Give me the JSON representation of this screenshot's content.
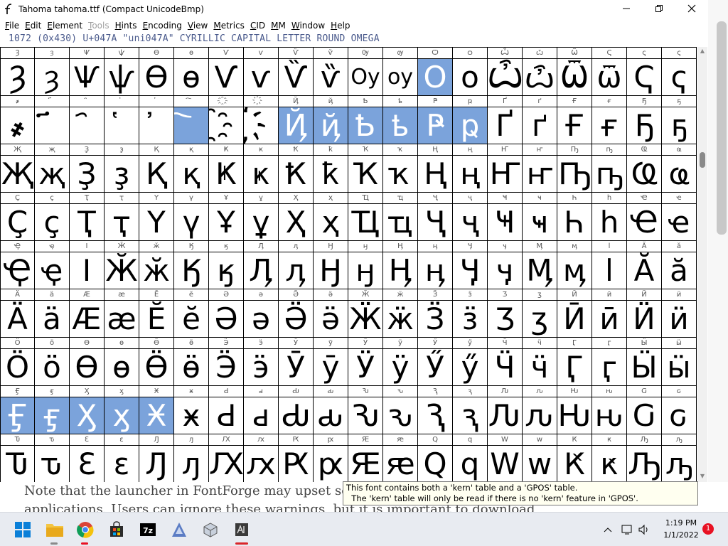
{
  "window": {
    "title": "Tahoma  tahoma.ttf (Compact UnicodeBmp)",
    "icon": "fontforge-icon",
    "minimize_glyph": "—",
    "maximize_glyph": "□",
    "close_glyph": "✕"
  },
  "menu": [
    {
      "label": "File",
      "u": "F",
      "rest": "ile",
      "enabled": true
    },
    {
      "label": "Edit",
      "u": "E",
      "rest": "dit",
      "enabled": true
    },
    {
      "label": "Element",
      "u": "E",
      "rest": "lement",
      "enabled": true
    },
    {
      "label": "Tools",
      "u": "T",
      "rest": "ools",
      "enabled": false
    },
    {
      "label": "Hints",
      "u": "H",
      "rest": "ints",
      "enabled": true
    },
    {
      "label": "Encoding",
      "u": "E",
      "rest": "ncoding",
      "enabled": true
    },
    {
      "label": "View",
      "u": "V",
      "rest": "iew",
      "enabled": true
    },
    {
      "label": "Metrics",
      "u": "M",
      "rest": "etrics",
      "enabled": true
    },
    {
      "label": "CID",
      "u": "C",
      "rest": "ID",
      "enabled": true
    },
    {
      "label": "MM",
      "u": "M",
      "rest": "M",
      "enabled": true
    },
    {
      "label": "Window",
      "u": "W",
      "rest": "indow",
      "enabled": true
    },
    {
      "label": "Help",
      "u": "H",
      "rest": "elp",
      "enabled": true
    }
  ],
  "info_line": "1072 (0x430) U+047A \"uni047A\" CYRILLIC CAPITAL LETTER ROUND OMEGA",
  "glyph_rows": [
    {
      "labels": [
        "Ȝ",
        "ȝ",
        "Ѱ",
        "ѱ",
        "Ѳ",
        "ѳ",
        "Ѵ",
        "ѵ",
        "Ѷ",
        "ѷ",
        "Ѹ",
        "ѹ",
        "Ѻ",
        "ѻ",
        "Ѽ",
        "ѽ",
        "Ѿ",
        "Ҁ",
        "ҁ",
        "ҁ"
      ],
      "glyphs": [
        "Ȝ",
        "ȝ",
        "Ѱ",
        "ѱ",
        "Ѳ",
        "ѳ",
        "Ѵ",
        "ѵ",
        "Ѷ",
        "ѷ",
        "Оу",
        "оу",
        "О",
        "о",
        "Ѽ",
        "ѽ",
        "Ѿ",
        "ѿ",
        "Ҁ",
        "ҁ"
      ],
      "selected": [
        12
      ]
    },
    {
      "labels": [
        "҂",
        "҃",
        "҄",
        "҅",
        "҆",
        "҇",
        "҈",
        "҉",
        "Ҋ",
        "ҋ",
        "Ҍ",
        "ҍ",
        "Ҏ",
        "ҏ",
        "Ґ",
        "ґ",
        "Ғ",
        "ғ",
        "Ҕ",
        "ҕ"
      ],
      "glyphs": [
        "҂",
        "҃",
        "҄",
        "҅",
        "҆",
        "҇",
        "҈",
        "҉",
        "Ҋ",
        "ҋ",
        "Ҍ",
        "ҍ",
        "Ҏ",
        "ҏ",
        "Ґ",
        "ґ",
        "Ғ",
        "ғ",
        "Ҕ",
        "ҕ"
      ],
      "selected": [
        5,
        8,
        9,
        10,
        11,
        12,
        13
      ]
    },
    {
      "labels": [
        "Җ",
        "җ",
        "Ҙ",
        "ҙ",
        "Қ",
        "қ",
        "Ҝ",
        "ҝ",
        "Ҟ",
        "ҟ",
        "Ҡ",
        "ҡ",
        "Ң",
        "ң",
        "Ҥ",
        "ҥ",
        "Ҧ",
        "ҧ",
        "Ҩ",
        "ҩ"
      ],
      "glyphs": [
        "Җ",
        "җ",
        "Ҙ",
        "ҙ",
        "Қ",
        "қ",
        "Ҝ",
        "ҝ",
        "Ҟ",
        "ҟ",
        "Ҡ",
        "ҡ",
        "Ң",
        "ң",
        "Ҥ",
        "ҥ",
        "Ҧ",
        "ҧ",
        "Ҩ",
        "ҩ"
      ],
      "selected": []
    },
    {
      "labels": [
        "Ҫ",
        "ҫ",
        "Ҭ",
        "ҭ",
        "Ү",
        "ү",
        "Ұ",
        "ұ",
        "Ҳ",
        "ҳ",
        "Ҵ",
        "ҵ",
        "Ҷ",
        "ҷ",
        "Ҹ",
        "ҹ",
        "Һ",
        "һ",
        "Ҽ",
        "ҽ"
      ],
      "glyphs": [
        "Ҫ",
        "ҫ",
        "Ҭ",
        "ҭ",
        "Ү",
        "ү",
        "Ұ",
        "ұ",
        "Ҳ",
        "ҳ",
        "Ҵ",
        "ҵ",
        "Ҷ",
        "ҷ",
        "Ҹ",
        "ҹ",
        "Һ",
        "һ",
        "Ҽ",
        "ҽ"
      ],
      "selected": []
    },
    {
      "labels": [
        "Ҿ",
        "ҿ",
        "Ӏ",
        "Ӂ",
        "ӂ",
        "Ӄ",
        "ӄ",
        "Ӆ",
        "ӆ",
        "Ӈ",
        "ӈ",
        "Ӊ",
        "ӊ",
        "Ӌ",
        "ӌ",
        "Ӎ",
        "ӎ",
        "ӏ",
        "Ӑ",
        "ӑ"
      ],
      "glyphs": [
        "Ҿ",
        "ҿ",
        "Ӏ",
        "Ӂ",
        "ӂ",
        "Ӄ",
        "ӄ",
        "Ӆ",
        "ӆ",
        "Ӈ",
        "ӈ",
        "Ӊ",
        "ӊ",
        "Ӌ",
        "ӌ",
        "Ӎ",
        "ӎ",
        "ӏ",
        "Ӑ",
        "ӑ"
      ],
      "selected": []
    },
    {
      "labels": [
        "Ӓ",
        "ӓ",
        "Ӕ",
        "ӕ",
        "Ӗ",
        "ӗ",
        "Ә",
        "ә",
        "Ӛ",
        "ӛ",
        "Ӝ",
        "ӝ",
        "Ӟ",
        "ӟ",
        "Ӡ",
        "ӡ",
        "Ӣ",
        "ӣ",
        "Ӥ",
        "ӥ"
      ],
      "glyphs": [
        "Ӓ",
        "ӓ",
        "Ӕ",
        "ӕ",
        "Ӗ",
        "ӗ",
        "Ә",
        "ә",
        "Ӛ",
        "ӛ",
        "Ӝ",
        "ӝ",
        "Ӟ",
        "ӟ",
        "Ӡ",
        "ӡ",
        "Ӣ",
        "ӣ",
        "Ӥ",
        "ӥ"
      ],
      "selected": []
    },
    {
      "labels": [
        "Ӧ",
        "ӧ",
        "Ө",
        "ө",
        "Ӫ",
        "ӫ",
        "Ӭ",
        "ӭ",
        "Ӯ",
        "ӯ",
        "Ӱ",
        "ӱ",
        "Ӳ",
        "ӳ",
        "Ӵ",
        "ӵ",
        "Ӷ",
        "ӷ",
        "Ӹ",
        "ӹ"
      ],
      "glyphs": [
        "Ӧ",
        "ӧ",
        "Ө",
        "ө",
        "Ӫ",
        "ӫ",
        "Ӭ",
        "ӭ",
        "Ӯ",
        "ӯ",
        "Ӱ",
        "ӱ",
        "Ӳ",
        "ӳ",
        "Ӵ",
        "ӵ",
        "Ӷ",
        "ӷ",
        "Ӹ",
        "ӹ"
      ],
      "selected": []
    },
    {
      "labels": [
        "Ӻ",
        "ӻ",
        "Ӽ",
        "ӽ",
        "Ӿ",
        "ӿ",
        "Ԁ",
        "ԁ",
        "Ԃ",
        "ԃ",
        "Ԅ",
        "ԅ",
        "Ԇ",
        "ԇ",
        "Ԉ",
        "ԉ",
        "Ԋ",
        "ԋ",
        "Ԍ",
        "ԍ"
      ],
      "glyphs": [
        "Ӻ",
        "ӻ",
        "Ӽ",
        "ӽ",
        "Ӿ",
        "ӿ",
        "Ԁ",
        "ԁ",
        "Ԃ",
        "ԃ",
        "Ԅ",
        "ԅ",
        "Ԇ",
        "ԇ",
        "Ԉ",
        "ԉ",
        "Ԋ",
        "ԋ",
        "Ԍ",
        "ԍ"
      ],
      "selected": [
        0,
        1,
        2,
        3,
        4
      ]
    },
    {
      "labels": [
        "Ԏ",
        "ԏ",
        "Ԑ",
        "ԑ",
        "Ԓ",
        "ԓ",
        "Ԕ",
        "ԕ",
        "Ԗ",
        "ԗ",
        "Ԙ",
        "ԙ",
        "Ԛ",
        "ԛ",
        "Ԝ",
        "ԝ",
        "Ԟ",
        "ԟ",
        "Ԡ",
        "ԡ"
      ],
      "glyphs": [
        "Ԏ",
        "ԏ",
        "Ԑ",
        "ԑ",
        "Ԓ",
        "ԓ",
        "Ԕ",
        "ԕ",
        "Ԗ",
        "ԗ",
        "Ԙ",
        "ԙ",
        "Ԛ",
        "ԛ",
        "Ԝ",
        "ԝ",
        "Ԟ",
        "ԟ",
        "Ԡ",
        "ԡ"
      ],
      "selected": []
    }
  ],
  "background_doc": {
    "line1": "Note that the launcher in FontForge may upset some a",
    "line2": "applications. Users can ignore these warnings, but it is important to download"
  },
  "tooltip": {
    "line1": "This font contains both a 'kern' table and a 'GPOS' table.",
    "line2": "  The 'kern' table will only be read if there is no 'kern' feature in 'GPOS'."
  },
  "taskbar": {
    "apps": [
      "start-icon",
      "file-explorer-icon",
      "chrome-icon",
      "store-icon",
      "7zip-icon",
      "fontforge-app-icon",
      "app-cube-icon",
      "fontforge-window-icon"
    ],
    "time": "1:19 PM",
    "date": "1/1/2022",
    "notifications": "1"
  },
  "colors": {
    "selection": "#7ba3db",
    "info_text": "#4a5a8c",
    "taskbar": "#e8ebf1"
  }
}
